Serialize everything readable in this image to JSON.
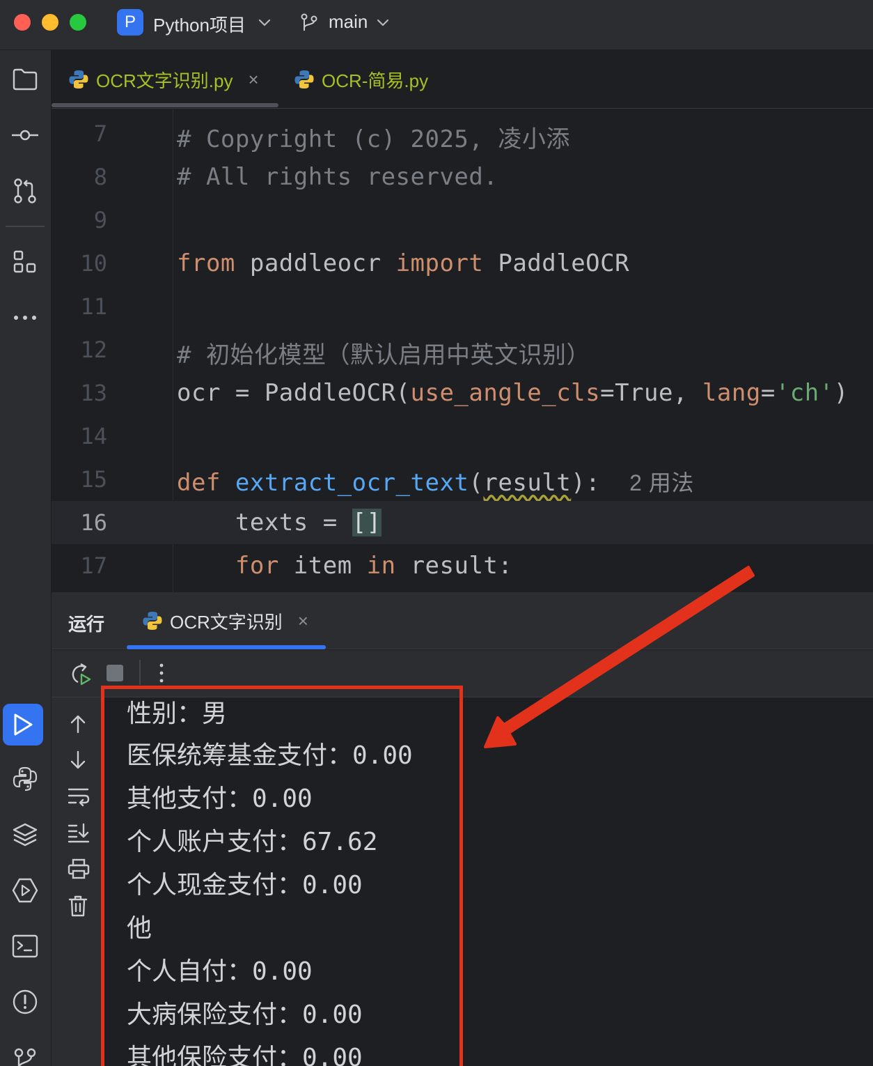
{
  "titlebar": {
    "project_badge": "P",
    "project_name": "Python项目",
    "branch_name": "main"
  },
  "editor_tabs": [
    {
      "label": "OCR文字识别.py",
      "active": true,
      "close": "×"
    },
    {
      "label": "OCR-简易.py",
      "active": false
    }
  ],
  "code_lines": [
    {
      "n": "7"
    },
    {
      "n": "8"
    },
    {
      "n": "9"
    },
    {
      "n": "10"
    },
    {
      "n": "11"
    },
    {
      "n": "12"
    },
    {
      "n": "13"
    },
    {
      "n": "14"
    },
    {
      "n": "15"
    },
    {
      "n": "16"
    },
    {
      "n": "17"
    }
  ],
  "code": {
    "l7": "# Copyright (c) 2025, 凌小添",
    "l8": "# All rights reserved.",
    "l10_kw1": "from",
    "l10_mod": " paddleocr ",
    "l10_kw2": "import",
    "l10_cls": " PaddleOCR",
    "l12": "# 初始化模型（默认启用中英文识别）",
    "l13_a": "ocr = PaddleOCR(",
    "l13_p1": "use_angle_cls",
    "l13_b": "=True, ",
    "l13_p2": "lang",
    "l13_c": "=",
    "l13_s": "'ch'",
    "l13_d": ")",
    "l15_kw": "def",
    "l15_fn": " extract_ocr_text",
    "l15_a": "(",
    "l15_arg": "result",
    "l15_b": "):",
    "l15_hint": "2 用法",
    "l16_a": "    texts = ",
    "l16_br": "[]",
    "l17_kw1": "for",
    "l17_a": " item ",
    "l17_kw2": "in",
    "l17_b": " result:"
  },
  "run_panel": {
    "title": "运行",
    "tab_label": "OCR文字识别",
    "tab_close": "×"
  },
  "console_output": [
    "性别：男",
    "医保统筹基金支付：0.00",
    "其他支付：0.00",
    "个人账户支付：67.62",
    "个人现金支付：0.00",
    "他",
    "个人自付：0.00",
    "大病保险支付：0.00",
    "其他保险支付：0.00"
  ],
  "colors": {
    "accent": "#3574f0",
    "annotation_red": "#e2321b",
    "tab_filename": "#a8c023"
  }
}
